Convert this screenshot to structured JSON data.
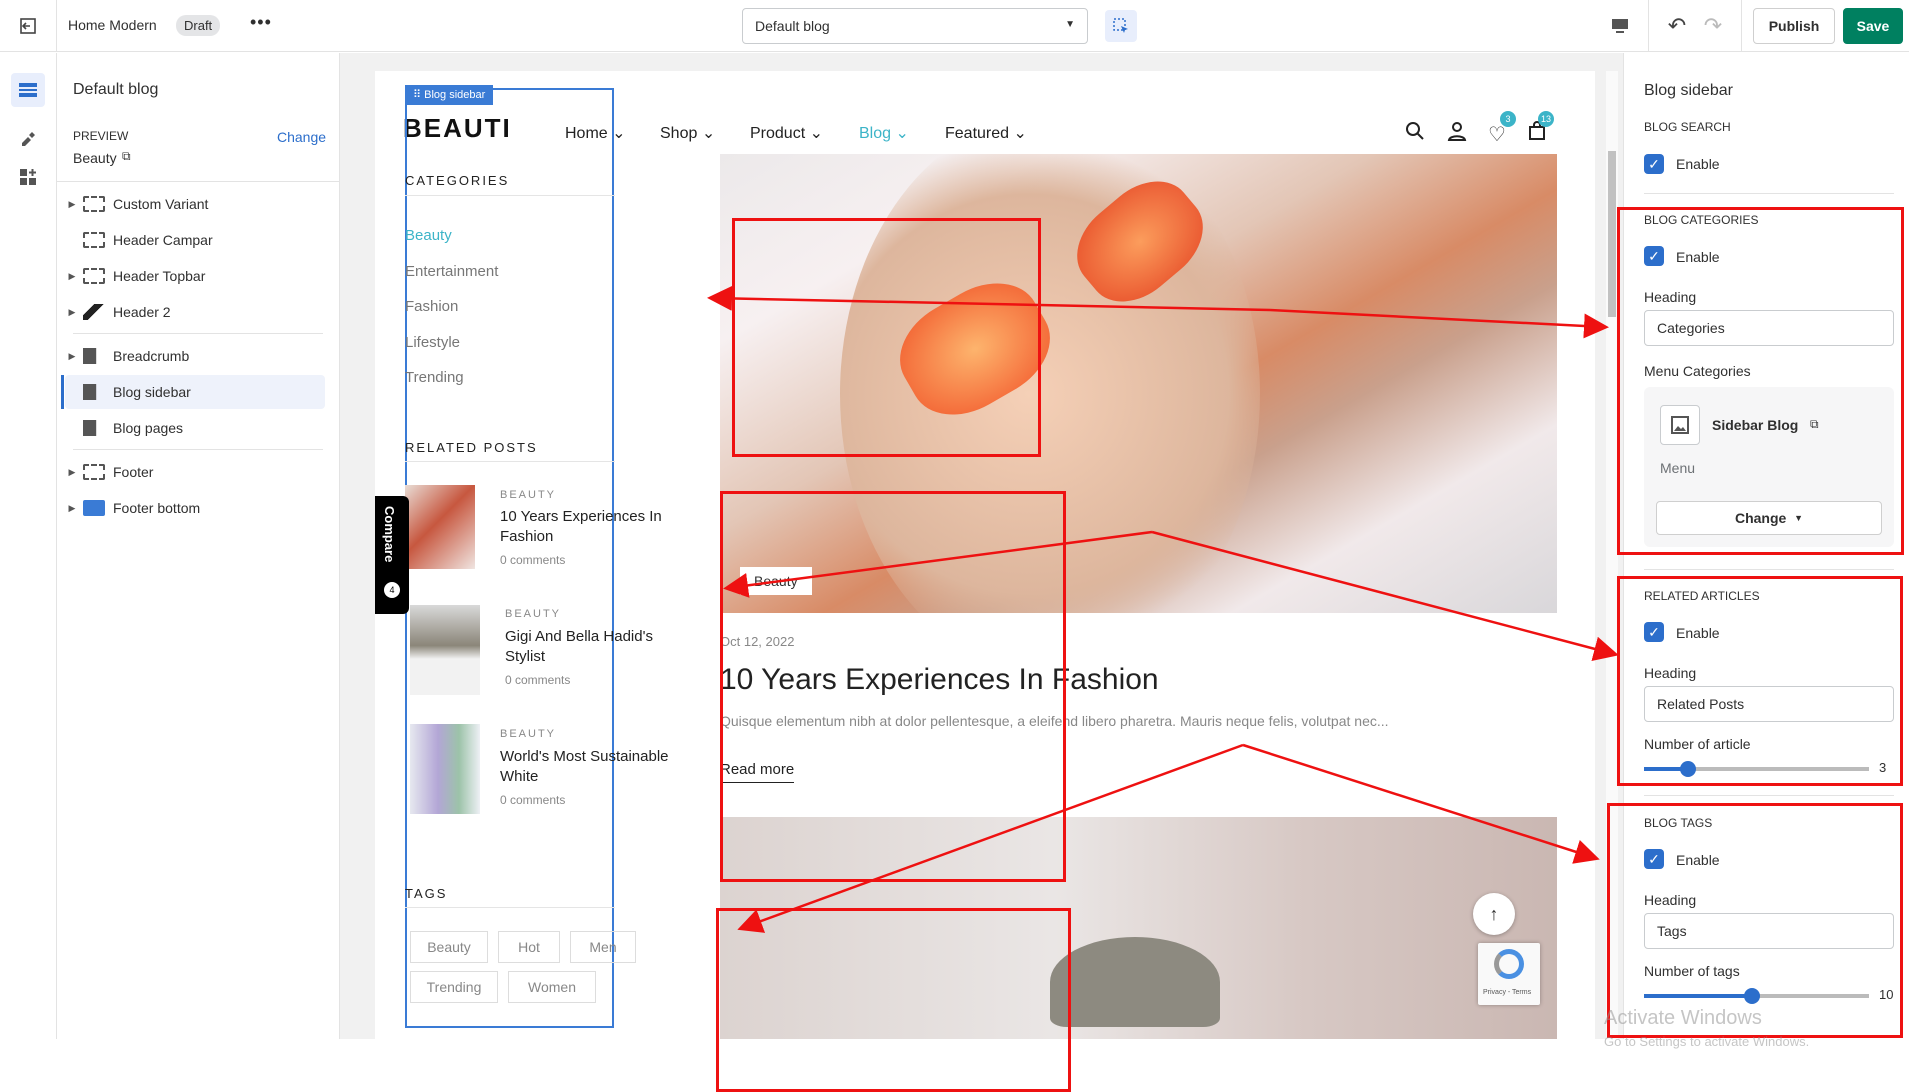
{
  "topbar": {
    "theme_name": "Home Modern",
    "status_badge": "Draft",
    "template_select": "Default blog",
    "publish_label": "Publish",
    "save_label": "Save"
  },
  "leftpanel": {
    "title": "Default blog",
    "preview_label": "PREVIEW",
    "change_link": "Change",
    "preview_value": "Beauty",
    "items": [
      {
        "label": "Custom Variant",
        "icon": "section-icon",
        "caret": true
      },
      {
        "label": "Header Campar",
        "icon": "section-icon",
        "caret": false
      },
      {
        "label": "Header Topbar",
        "icon": "section-icon",
        "caret": true
      },
      {
        "label": "Header 2",
        "icon": "header-icon",
        "caret": true
      },
      {
        "label": "Breadcrumb",
        "icon": "template-icon",
        "caret": true
      },
      {
        "label": "Blog sidebar",
        "icon": "template-icon",
        "caret": false
      },
      {
        "label": "Blog pages",
        "icon": "template-icon",
        "caret": false
      },
      {
        "label": "Footer",
        "icon": "section-icon",
        "caret": true
      },
      {
        "label": "Footer bottom",
        "icon": "section-icon",
        "caret": true
      }
    ]
  },
  "store": {
    "logo": "BEAUTI",
    "sidebar_badge": "Blog sidebar",
    "nav": [
      "Home",
      "Shop",
      "Product",
      "Blog",
      "Featured"
    ],
    "wishlist_count": "3",
    "cart_count": "13",
    "compare_label": "Compare",
    "compare_count": "4",
    "categories_heading": "CATEGORIES",
    "categories": [
      "Beauty",
      "Entertainment",
      "Fashion",
      "Lifestyle",
      "Trending"
    ],
    "related_heading": "RELATED POSTS",
    "related": [
      {
        "tag": "BEAUTY",
        "title": "10 Years Experiences In Fashion",
        "comments": "0 comments"
      },
      {
        "tag": "BEAUTY",
        "title": "Gigi And Bella Hadid's Stylist",
        "comments": "0 comments"
      },
      {
        "tag": "BEAUTY",
        "title": "World's Most Sustainable White",
        "comments": "0 comments"
      }
    ],
    "tags_heading": "TAGS",
    "tags": [
      "Beauty",
      "Hot",
      "Men",
      "Trending",
      "Women"
    ],
    "post_badge": "Beauty",
    "post_date": "Oct 12, 2022",
    "post_title": "10 Years Experiences In Fashion",
    "post_excerpt": "Quisque elementum nibh at dolor pellentesque, a eleifend libero pharetra. Mauris neque felis, volutpat nec...",
    "read_more": "Read more",
    "recaptcha_text": "Privacy - Terms"
  },
  "rightpanel": {
    "title": "Blog sidebar",
    "search_heading": "BLOG SEARCH",
    "enable": "Enable",
    "cat_heading": "BLOG CATEGORIES",
    "heading_label": "Heading",
    "cat_value": "Categories",
    "menu_label": "Menu Categories",
    "menu_name": "Sidebar Blog",
    "menu_sub": "Menu",
    "change_btn": "Change",
    "related_heading": "RELATED ARTICLES",
    "related_value": "Related Posts",
    "num_article_label": "Number of article",
    "num_article": "3",
    "tags_heading": "BLOG TAGS",
    "tags_value": "Tags",
    "num_tags_label": "Number of tags",
    "num_tags": "10",
    "watermark_1": "Activate Windows",
    "watermark_2": "Go to Settings to activate Windows."
  },
  "colors": {
    "accent": "#2c6ecb",
    "save": "#008060",
    "annotation": "#e11111",
    "blog_link": "#3cb4c8"
  }
}
